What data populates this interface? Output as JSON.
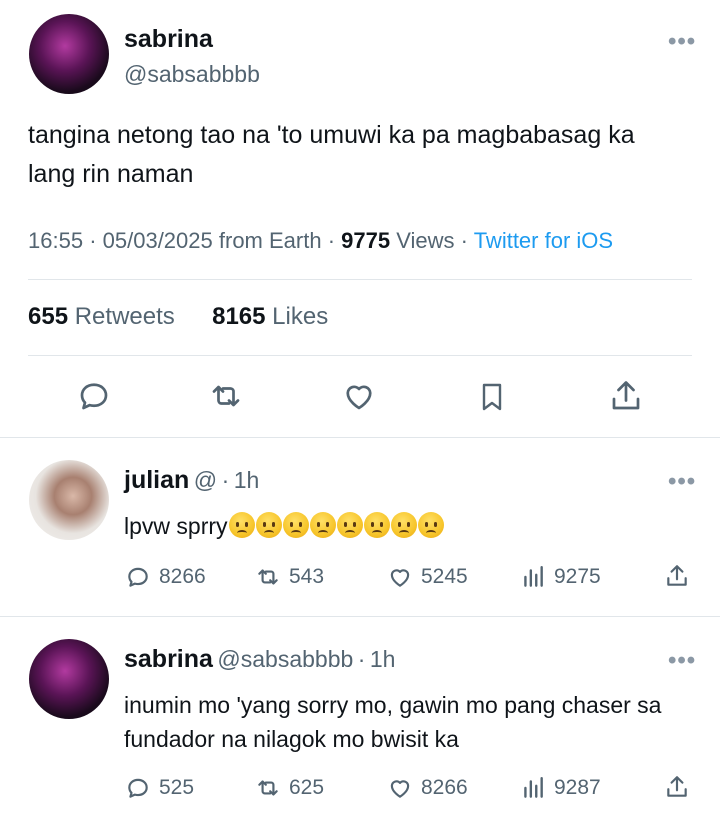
{
  "main_tweet": {
    "name": "sabrina",
    "handle": "@sabsabbbb",
    "text": "tangina netong tao na 'to umuwi ka pa magbabasag ka lang rin naman",
    "time": "16:55",
    "date": "05/03/2025",
    "location": "from Earth",
    "views_count": "9775",
    "views_label": "Views",
    "client": "Twitter for iOS",
    "retweets_count": "655",
    "retweets_label": "Retweets",
    "likes_count": "8165",
    "likes_label": "Likes",
    "more_label": "•••"
  },
  "replies": [
    {
      "name": "julian",
      "handle": "@",
      "time": "1h",
      "text": "lpvw sprry",
      "emoji_count": 8,
      "replies": "8266",
      "retweets": "543",
      "likes": "5245",
      "views": "9275",
      "more_label": "•••"
    },
    {
      "name": "sabrina",
      "handle": "@sabsabbbb",
      "time": "1h",
      "text": "inumin mo 'yang sorry mo, gawin mo pang chaser sa fundador na nilagok mo bwisit ka",
      "replies": "525",
      "retweets": "625",
      "likes": "8266",
      "views": "9287",
      "more_label": "•••"
    }
  ],
  "colors": {
    "text": "#0f1419",
    "secondary": "#536471",
    "link": "#1d9bf0",
    "divider": "#e1e6ea"
  },
  "icons": [
    "reply-icon",
    "retweet-icon",
    "like-icon",
    "bookmark-icon",
    "share-icon",
    "views-icon",
    "more-icon"
  ]
}
